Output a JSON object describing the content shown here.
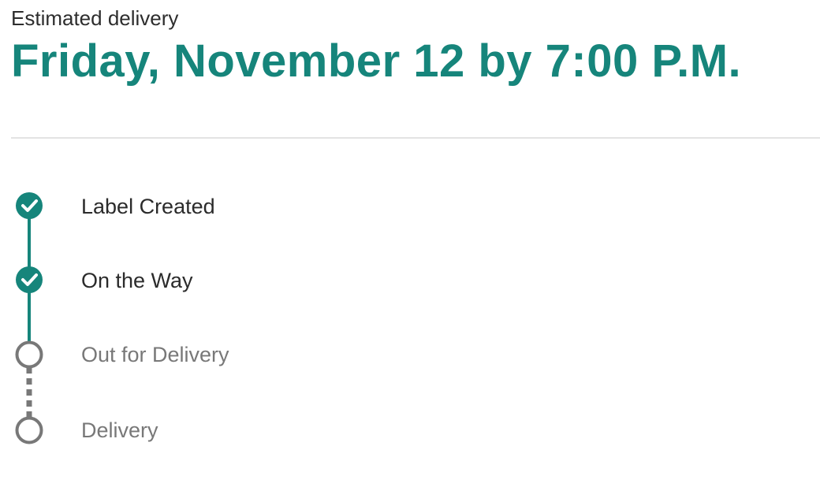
{
  "delivery": {
    "eyebrow": "Estimated delivery",
    "date_time": "Friday, November 12 by 7:00 P.M."
  },
  "tracking": {
    "steps": [
      {
        "label": "Label Created",
        "status": "complete",
        "icon": "check-circle-icon"
      },
      {
        "label": "On the Way",
        "status": "complete",
        "icon": "check-circle-icon"
      },
      {
        "label": "Out for Delivery",
        "status": "pending",
        "icon": "empty-circle-icon"
      },
      {
        "label": "Delivery",
        "status": "pending",
        "icon": "empty-circle-icon"
      }
    ]
  },
  "colors": {
    "accent": "#16857b",
    "pending": "#787878",
    "text": "#2b2b2b",
    "divider": "#e3e3e3"
  }
}
